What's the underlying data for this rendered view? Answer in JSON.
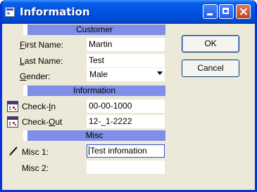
{
  "window": {
    "title": "Information"
  },
  "sections": {
    "customer": "Customer",
    "information": "Information",
    "misc": "Misc"
  },
  "fields": {
    "first_name": {
      "label_before": "",
      "label_accel": "F",
      "label_after": "irst Name:",
      "value": "Martin"
    },
    "last_name": {
      "label_before": "",
      "label_accel": "L",
      "label_after": "ast Name:",
      "value": "Test"
    },
    "gender": {
      "label_before": "",
      "label_accel": "G",
      "label_after": "ender:",
      "value": "Male"
    },
    "check_in": {
      "label_before": "Check-",
      "label_accel": "I",
      "label_after": "n",
      "value": "00-00-1000"
    },
    "check_out": {
      "label_before": "Check-",
      "label_accel": "O",
      "label_after": "ut",
      "value": "12-_1-2222"
    },
    "misc1": {
      "label": "Misc 1:",
      "value": "Test infomation"
    },
    "misc2": {
      "label": "Misc 2:",
      "value": ""
    }
  },
  "buttons": {
    "ok": "OK",
    "cancel": "Cancel"
  },
  "icons": {
    "window": "form-icon",
    "check_in": "calendar-icon",
    "check_out": "calendar-icon",
    "misc1": "pencil-icon",
    "dropdown": "chevron-down-icon"
  },
  "colors": {
    "header_bar": "#7f8ee6",
    "titlebar": "#0052e0",
    "dialog_bg": "#ece9d8",
    "focus_border": "#2e4ed5"
  }
}
